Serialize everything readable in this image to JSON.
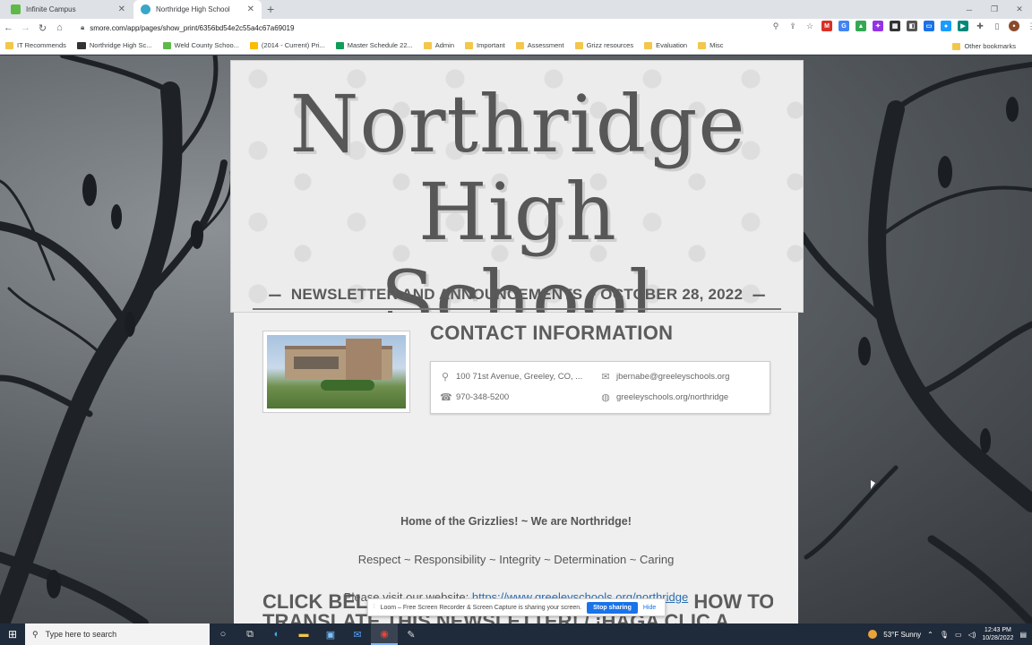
{
  "browser": {
    "tabs": [
      {
        "title": "Infinite Campus",
        "favicon_color": "#5fb94a"
      },
      {
        "title": "Northridge High School",
        "favicon_color": "#3aa6c9"
      }
    ],
    "url": "smore.com/app/pages/show_print/6356bd54e2c55a4c67a69019",
    "bookmarks": [
      {
        "label": "IT Recommends",
        "icon": "folder-icon"
      },
      {
        "label": "Northridge High Sc...",
        "icon": "blackboard-icon"
      },
      {
        "label": "Weld County Schoo...",
        "icon": "campus-icon"
      },
      {
        "label": "(2014 - Current) Pri...",
        "icon": "drive-icon"
      },
      {
        "label": "Master Schedule 22...",
        "icon": "sheets-icon"
      },
      {
        "label": "Admin",
        "icon": "folder-icon"
      },
      {
        "label": "Important",
        "icon": "folder-icon"
      },
      {
        "label": "Assessment",
        "icon": "folder-icon"
      },
      {
        "label": "Grizz resources",
        "icon": "folder-icon"
      },
      {
        "label": "Evaluation",
        "icon": "folder-icon"
      },
      {
        "label": "Misc",
        "icon": "folder-icon"
      }
    ],
    "other_bookmarks": "Other bookmarks"
  },
  "newsletter": {
    "title_line1": "Northridge High",
    "title_line2": "School",
    "subtitle": "NEWSLETTER AND ANNOUNCEMENTS ~ OCTOBER 28, 2022",
    "contact_title": "CONTACT INFORMATION",
    "address": "100 71st Avenue, Greeley, CO, ...",
    "email": "jbernabe@greeleyschools.org",
    "phone": "970-348-5200",
    "website_short": "greeleyschools.org/northridge",
    "tagline": "Home of the Grizzlies! ~ We are Northridge!",
    "values": "Respect ~ Responsibility ~ Integrity ~ Determination ~ Caring",
    "visit_text": "Please visit our website: ",
    "visit_link": "https://www.greeleyschools.org/northridge",
    "click_heading_start": "CLICK BEL",
    "click_heading_end": "HOW TO",
    "click_heading_line2": "TRANSLATE THIS NEWSLETTER! / ¡HAGA CLIC A"
  },
  "loom": {
    "message": "Loom – Free Screen Recorder & Screen Capture is sharing your screen.",
    "stop_label": "Stop sharing",
    "hide_label": "Hide"
  },
  "taskbar": {
    "search_placeholder": "Type here to search",
    "weather": "53°F  Sunny",
    "time": "12:43 PM",
    "date": "10/28/2022"
  }
}
